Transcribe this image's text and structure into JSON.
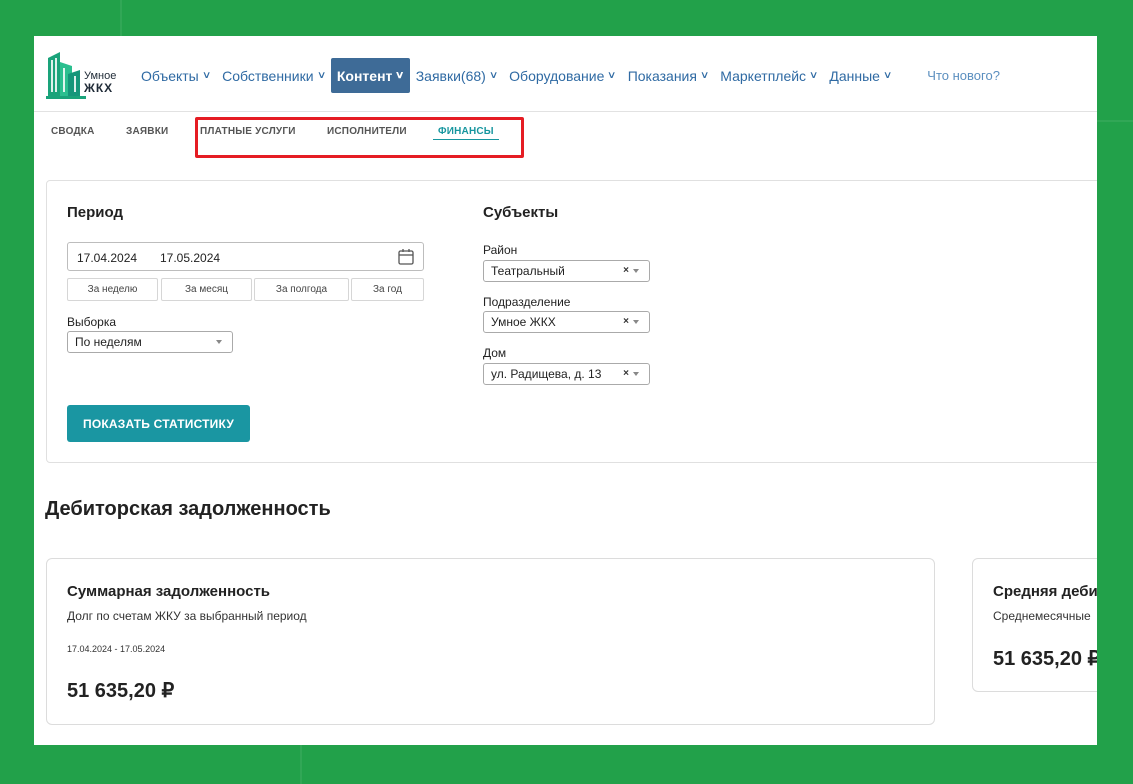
{
  "brand": {
    "line1": "Умное",
    "line2": "ЖКХ"
  },
  "nav": {
    "items": [
      {
        "label": "Объекты",
        "active": false
      },
      {
        "label": "Собственники",
        "active": false
      },
      {
        "label": "Контент",
        "active": true
      },
      {
        "label": "Заявки(68)",
        "active": false
      },
      {
        "label": "Оборудование",
        "active": false
      },
      {
        "label": "Показания",
        "active": false
      },
      {
        "label": "Маркетплейс",
        "active": false
      },
      {
        "label": "Данные",
        "active": false
      }
    ],
    "whats_new": "Что нового?"
  },
  "subtabs": [
    "Сводка",
    "Заявки",
    "Платные услуги",
    "Исполнители",
    "Финансы"
  ],
  "subtabs_active": "Финансы",
  "filters": {
    "period_title": "Период",
    "date_from": "17.04.2024",
    "date_to": "17.05.2024",
    "quick_ranges": [
      "За неделю",
      "За месяц",
      "За полгода",
      "За год"
    ],
    "sample_label": "Выборка",
    "sample_value": "По неделям",
    "subjects_title": "Субъекты",
    "district_label": "Район",
    "district_value": "Театральный",
    "division_label": "Подразделение",
    "division_value": "Умное ЖКХ",
    "house_label": "Дом",
    "house_value": "ул. Радищева, д. 13",
    "show_button": "ПОКАЗАТЬ СТАТИСТИКУ"
  },
  "receivables": {
    "title": "Дебиторская задолженность",
    "card1": {
      "title": "Суммарная задолженность",
      "subtitle": "Долг по счетам ЖКУ за выбранный период",
      "period": "17.04.2024 - 17.05.2024",
      "value": "51 635,20 ₽"
    },
    "card2": {
      "title": "Средняя деби",
      "subtitle": "Среднемесячные",
      "value": "51 635,20 ₽"
    }
  },
  "colors": {
    "background": "#22a14a",
    "nav_active": "#3e6b97",
    "accent": "#1a96a2",
    "highlight": "#e51c23"
  }
}
